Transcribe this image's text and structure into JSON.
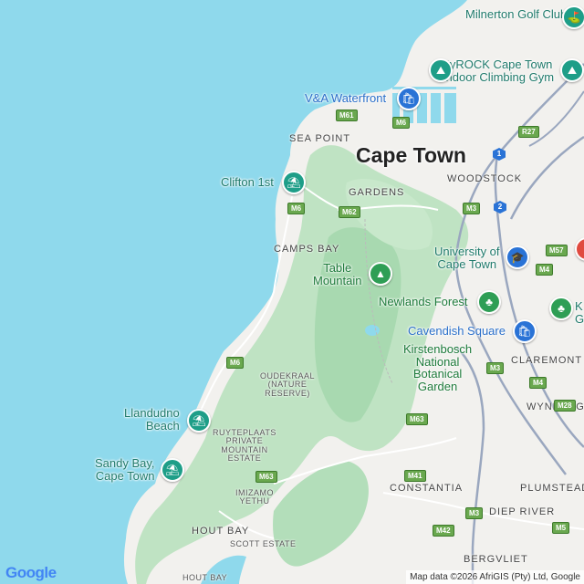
{
  "map": {
    "city_label": "Cape Town",
    "area_labels": [
      {
        "id": "sea-point",
        "text": "SEA POINT"
      },
      {
        "id": "gardens",
        "text": "GARDENS"
      },
      {
        "id": "woodstock",
        "text": "WOODSTOCK"
      },
      {
        "id": "camps-bay",
        "text": "CAMPS BAY"
      },
      {
        "id": "claremont",
        "text": "CLAREMONT"
      },
      {
        "id": "wynberg",
        "text": "WYNBERG"
      },
      {
        "id": "constantia",
        "text": "CONSTANTIA"
      },
      {
        "id": "plumstead",
        "text": "PLUMSTEAD"
      },
      {
        "id": "diep-river",
        "text": "DIEP RIVER"
      },
      {
        "id": "hout-bay",
        "text": "HOUT BAY"
      },
      {
        "id": "bergvliet",
        "text": "BERGVLIET"
      },
      {
        "id": "scott-estate",
        "text": "SCOTT ESTATE"
      },
      {
        "id": "hout-bay-harbour",
        "text": "HOUT BAY"
      }
    ],
    "small_areas": {
      "oudekraal": "OUDEKRAAL\n(NATURE\nRESERVE)",
      "ruyteplaats": "RUYTEPLAATS\nPRIVATE\nMOUNTAIN\nESTATE",
      "imizamo": "IMIZAMO\nYETHU"
    },
    "pois": {
      "milnerton": "Milnerton Golf Club",
      "cityrock": "CityROCK Cape Town\n- Indoor Climbing Gym",
      "va_waterfront": "V&A Waterfront",
      "clifton": "Clifton 1st",
      "uct": "University of\nCape Town",
      "table_mountain": "Table\nMountain",
      "newlands": "Newlands Forest",
      "cavendish": "Cavendish Square",
      "kirstenbosch": "Kirstenbosch\nNational\nBotanical\nGarden",
      "llandudno": "Llandudno\nBeach",
      "sandy_bay": "Sandy Bay,\nCape Town",
      "k_partial": "K\nG"
    },
    "road_shields": {
      "m61": "M61",
      "m6_a": "M6",
      "m6_b": "M6",
      "m6_c": "M6",
      "m62": "M62",
      "m3_a": "M3",
      "m3_b": "M3",
      "m3_c": "M3",
      "r27": "R27",
      "m57": "M57",
      "m4_a": "M4",
      "m4_b": "M4",
      "m63_a": "M63",
      "m63_b": "M63",
      "m41": "M41",
      "m42": "M42",
      "m28": "M28",
      "m5": "M5",
      "n1": "1",
      "n2": "2"
    }
  },
  "footer": {
    "logo": "Google",
    "attribution": "Map data ©2026 AfriGIS (Pty) Ltd, Google"
  }
}
